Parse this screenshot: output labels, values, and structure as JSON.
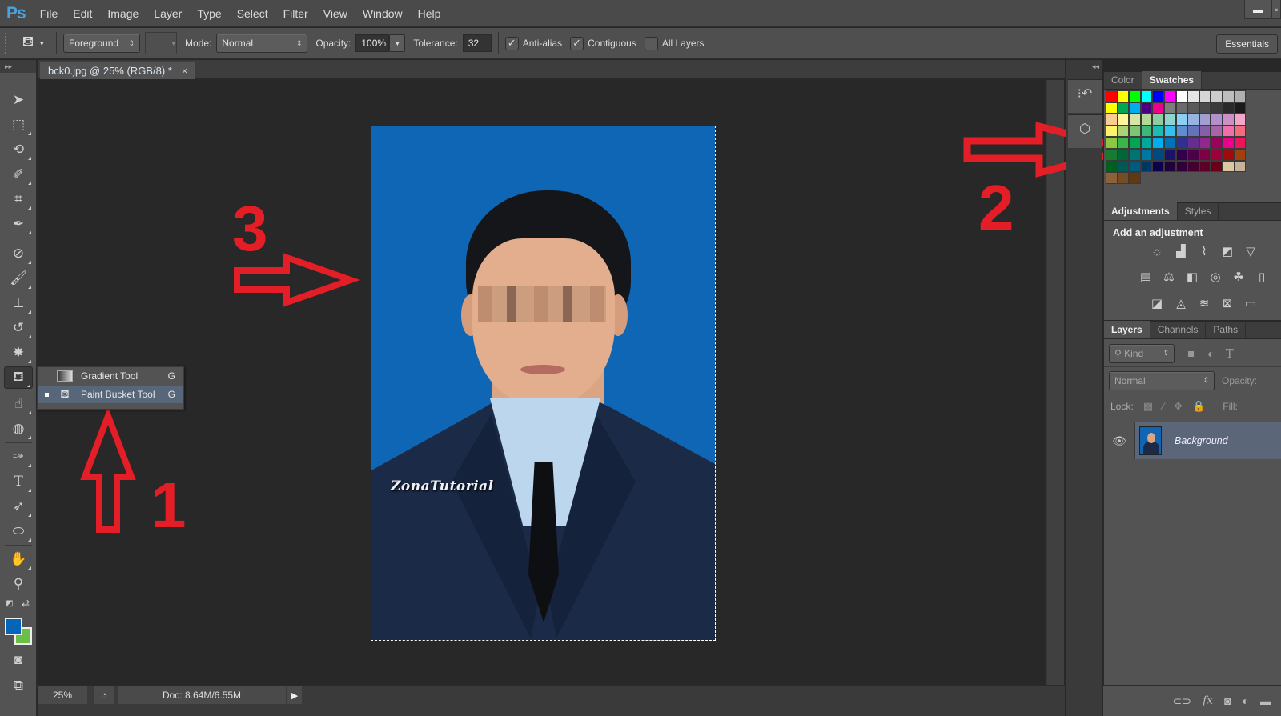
{
  "app": {
    "logo": "Ps",
    "menu": [
      "File",
      "Edit",
      "Image",
      "Layer",
      "Type",
      "Select",
      "Filter",
      "View",
      "Window",
      "Help"
    ],
    "window_controls": [
      "minimize",
      "restore"
    ]
  },
  "options_bar": {
    "tool_icon": "paint-bucket-icon",
    "fill_source": "Foreground",
    "mode_label": "Mode:",
    "mode_value": "Normal",
    "opacity_label": "Opacity:",
    "opacity_value": "100%",
    "tolerance_label": "Tolerance:",
    "tolerance_value": "32",
    "anti_alias_label": "Anti-alias",
    "anti_alias_checked": true,
    "contiguous_label": "Contiguous",
    "contiguous_checked": true,
    "all_layers_label": "All Layers",
    "all_layers_checked": false,
    "workspace": "Essentials"
  },
  "document": {
    "tab_title": "bck0.jpg @ 25% (RGB/8) *",
    "close_glyph": "×",
    "watermark": "ZonaTutorial"
  },
  "toolbar": {
    "tools": [
      "move-tool",
      "marquee-tool",
      "lasso-tool",
      "quick-selection-tool",
      "crop-tool",
      "eyedropper-tool",
      "healing-brush-tool",
      "brush-tool",
      "clone-stamp-tool",
      "history-brush-tool",
      "eraser-tool",
      "paint-bucket-tool",
      "smudge-tool",
      "sponge-tool",
      "pen-tool",
      "type-tool",
      "path-selection-tool",
      "ellipse-tool",
      "hand-tool",
      "zoom-tool"
    ],
    "active_tool": "paint-bucket-tool",
    "foreground_color": "#0565bb",
    "background_color": "#6ac046"
  },
  "flyout": {
    "items": [
      {
        "label": "Gradient Tool",
        "key": "G",
        "selected": false
      },
      {
        "label": "Paint Bucket Tool",
        "key": "G",
        "selected": true
      }
    ]
  },
  "annotations": {
    "labels": [
      "1",
      "2",
      "3"
    ],
    "color": "#e41e26"
  },
  "status": {
    "zoom": "25%",
    "doc_size": "Doc: 8.64M/6.55M"
  },
  "panels": {
    "swatches_tabs": [
      "Color",
      "Swatches"
    ],
    "swatches_active": "Swatches",
    "swatches": [
      [
        "#ff0000",
        "#ffff00",
        "#00ff00",
        "#00ffff",
        "#0000ff",
        "#ff00ff",
        "#ffffff",
        "#e6e6e6",
        "#d6d6d6",
        "#cccccc",
        "#bdbdbd",
        "#b0b0b0"
      ],
      [
        "#ffff00",
        "#00a651",
        "#00aeef",
        "#4b0082",
        "#ec008c",
        "#7d7d7d",
        "#6b6b6b",
        "#5a5a5a",
        "#4a4a4a",
        "#3a3a3a",
        "#2a2a2a",
        "#1a1a1a"
      ],
      [
        "#fbcd93",
        "#fff799",
        "#d7e6a4",
        "#b4d996",
        "#8ccf9e",
        "#8fd5ce",
        "#8dcff4",
        "#97b3df",
        "#a19fd1",
        "#b38fcb",
        "#cc8fc6",
        "#f3a6c8"
      ],
      [
        "#fff468",
        "#acd373",
        "#7dc473",
        "#3cb878",
        "#1cbbb4",
        "#33bff0",
        "#5e8ecf",
        "#6672b7",
        "#8560a8",
        "#a864a8",
        "#f06ea9",
        "#f26c7d"
      ],
      [
        "#8dc63f",
        "#39b54a",
        "#00a651",
        "#00a99d",
        "#00aeef",
        "#0072bc",
        "#2e3192",
        "#662d91",
        "#92278f",
        "#9e005d",
        "#ec008c",
        "#ed145b"
      ],
      [
        "#197b30",
        "#006838",
        "#007471",
        "#0076a3",
        "#004a80",
        "#1b1464",
        "#32004b",
        "#4b0049",
        "#7b0046",
        "#9e0039",
        "#9e0b0f",
        "#a0410d"
      ],
      [
        "#005e20",
        "#005952",
        "#005b7f",
        "#003663",
        "#0d004c",
        "#21003c",
        "#30003a",
        "#440031",
        "#5c0028",
        "#6a0018",
        "#d9c8a0",
        "#c7b299"
      ],
      [
        "#8c6239",
        "#754c24",
        "#603913"
      ]
    ],
    "adjustments_tabs": [
      "Adjustments",
      "Styles"
    ],
    "adjustments_active": "Adjustments",
    "adjustments_title": "Add an adjustment",
    "adjustment_icons": [
      [
        "brightness-contrast-icon",
        "levels-icon",
        "curves-icon",
        "exposure-icon",
        "vibrance-icon"
      ],
      [
        "hue-saturation-icon",
        "color-balance-icon",
        "black-white-icon",
        "photo-filter-icon",
        "channel-mixer-icon",
        "color-lookup-icon"
      ],
      [
        "invert-icon",
        "posterize-icon",
        "threshold-icon",
        "selective-color-icon",
        "gradient-map-icon"
      ]
    ],
    "layers_tabs": [
      "Layers",
      "Channels",
      "Paths"
    ],
    "layers_active": "Layers",
    "filter_kind": "Kind",
    "blend_mode": "Normal",
    "opacity_label": "Opacity:",
    "lock_label": "Lock:",
    "fill_label": "Fill:",
    "layers": [
      {
        "name": "Background",
        "visible": true,
        "selected": true
      }
    ],
    "footer_icons": [
      "link-layers-icon",
      "fx-icon",
      "layer-mask-icon",
      "adjustment-layer-icon",
      "group-folder-icon"
    ]
  }
}
